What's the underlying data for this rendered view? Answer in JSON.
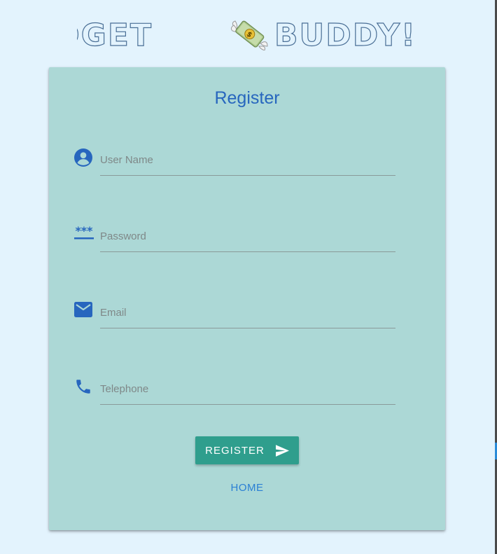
{
  "header": {
    "title_left": "BUDGET",
    "title_right": "BUDDY!",
    "emoji": "💸",
    "emoji_icon": "money-with-wings-icon"
  },
  "form": {
    "title": "Register",
    "fields": [
      {
        "name": "username",
        "placeholder": "User Name",
        "value": "",
        "icon": "account-circle-icon"
      },
      {
        "name": "password",
        "placeholder": "Password",
        "value": "",
        "icon": "password-icon"
      },
      {
        "name": "email",
        "placeholder": "Email",
        "value": "",
        "icon": "email-icon"
      },
      {
        "name": "telephone",
        "placeholder": "Telephone",
        "value": "",
        "icon": "phone-icon"
      }
    ],
    "submit_label": "REGISTER",
    "submit_icon": "send-icon",
    "home_label": "HOME"
  },
  "colors": {
    "page_background": "#e3f3fd",
    "card_background": "#acd8d6",
    "accent_blue": "#2766be",
    "button_teal": "#2f9e8d",
    "link_blue": "#2a7fd4"
  }
}
